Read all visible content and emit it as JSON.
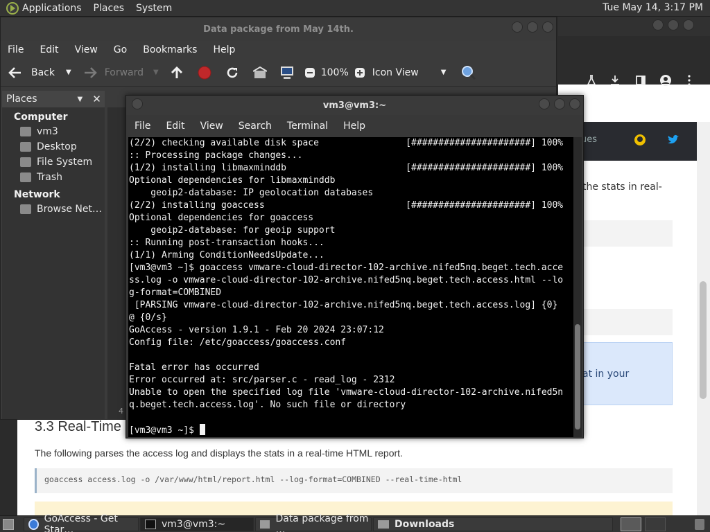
{
  "top_panel": {
    "menus": [
      "Applications",
      "Places",
      "System"
    ],
    "clock": "Tue May 14,  3:17 PM"
  },
  "browser": {
    "toolbar_icons": [
      "flask-icon",
      "download-icon",
      "sidebar-icon",
      "account-icon",
      "menu-icon"
    ],
    "article": {
      "fragments": [
        "ues",
        "the stats in real-",
        "at in your"
      ],
      "heading": "3.3 Real-Time",
      "heading_num": "4",
      "paragraph": "The following parses the access log and displays the stats in a real-time HTML report.",
      "code": "goaccess access.log -o /var/www/html/report.html --log-format=COMBINED --real-time-html",
      "social_colors": {
        "github": "#f0c000",
        "twitter": "#1da1f2"
      }
    }
  },
  "file_manager": {
    "title": "Data package from May 14th.",
    "menu": [
      "File",
      "Edit",
      "View",
      "Go",
      "Bookmarks",
      "Help"
    ],
    "toolbar": {
      "back": "Back",
      "forward": "Forward",
      "zoom": "100%",
      "view_mode": "Icon View"
    },
    "sidebar": {
      "header": "Places",
      "computer_heading": "Computer",
      "computer_items": [
        "vm3",
        "Desktop",
        "File System",
        "Trash"
      ],
      "network_heading": "Network",
      "network_items": [
        "Browse Net…"
      ]
    }
  },
  "terminal": {
    "title": "vm3@vm3:~",
    "menu": [
      "File",
      "Edit",
      "View",
      "Search",
      "Terminal",
      "Help"
    ],
    "lines": [
      "(2/2) checking available disk space                [######################] 100%",
      ":: Processing package changes...",
      "(1/2) installing libmaxminddb                      [######################] 100%",
      "Optional dependencies for libmaxminddb",
      "    geoip2-database: IP geolocation databases",
      "(2/2) installing goaccess                          [######################] 100%",
      "Optional dependencies for goaccess",
      "    geoip2-database: for geoip support",
      ":: Running post-transaction hooks...",
      "(1/1) Arming ConditionNeedsUpdate...",
      "[vm3@vm3 ~]$ goaccess vmware-cloud-director-102-archive.nifed5nq.beget.tech.acce",
      "ss.log -o vmware-cloud-director-102-archive.nifed5nq.beget.tech.access.html --lo",
      "g-format=COMBINED",
      " [PARSING vmware-cloud-director-102-archive.nifed5nq.beget.tech.access.log] {0}",
      "@ {0/s}",
      "GoAccess - version 1.9.1 - Feb 20 2024 23:07:12",
      "Config file: /etc/goaccess/goaccess.conf",
      "",
      "Fatal error has occurred",
      "Error occurred at: src/parser.c - read_log - 2312",
      "Unable to open the specified log file 'vmware-cloud-director-102-archive.nifed5n",
      "q.beget.tech.access.log'. No such file or directory",
      ""
    ],
    "prompt": "[vm3@vm3 ~]$ "
  },
  "taskbar": {
    "tasks": [
      "GoAccess - Get Star…",
      "vm3@vm3:~",
      "Data package from …",
      "Downloads"
    ]
  }
}
